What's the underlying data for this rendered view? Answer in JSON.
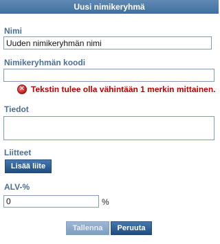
{
  "dialog": {
    "title": "Uusi nimikeryhmä"
  },
  "fields": {
    "name": {
      "label": "Nimi",
      "value": "Uuden nimikeryhmän nimi"
    },
    "code": {
      "label": "Nimikeryhmän koodi",
      "value": "",
      "error": "Tekstin tulee olla vähintään 1 merkin mittainen."
    },
    "info": {
      "label": "Tiedot",
      "value": ""
    },
    "attachments": {
      "label": "Liitteet",
      "add_button": "Lisää liite"
    },
    "vat": {
      "label": "ALV-%",
      "value": "0",
      "unit": "%"
    }
  },
  "actions": {
    "save": "Tallenna",
    "cancel": "Peruuta"
  },
  "colors": {
    "header": "#41709f",
    "label": "#4b6f95",
    "error": "#c00000",
    "button": "#1f4d82",
    "button_disabled": "#9db6d3"
  }
}
